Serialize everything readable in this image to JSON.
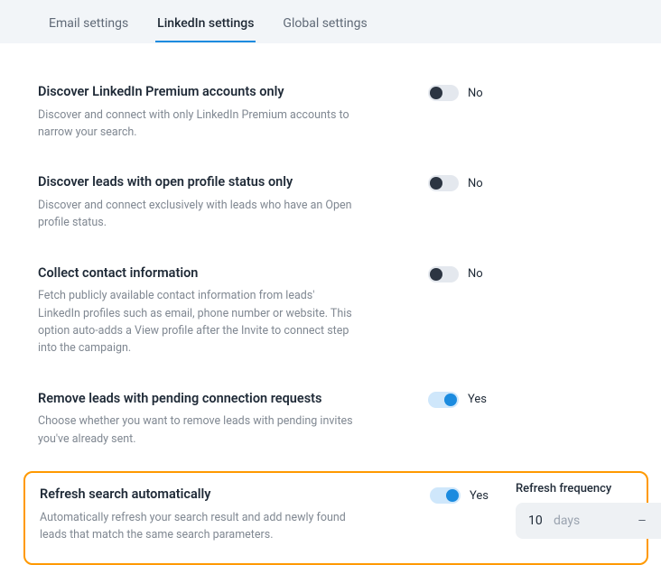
{
  "tabs": [
    {
      "label": "Email settings",
      "active": false
    },
    {
      "label": "LinkedIn settings",
      "active": true
    },
    {
      "label": "Global settings",
      "active": false
    }
  ],
  "settings": {
    "premium": {
      "title": "Discover LinkedIn Premium accounts only",
      "desc": "Discover and connect with only LinkedIn Premium accounts to narrow your search.",
      "value": false,
      "value_label": "No"
    },
    "open_profile": {
      "title": "Discover leads with open profile status only",
      "desc": "Discover and connect exclusively with leads who have an Open profile status.",
      "value": false,
      "value_label": "No"
    },
    "contact_info": {
      "title": "Collect contact information",
      "desc": "Fetch publicly available contact information from leads' LinkedIn profiles such as email, phone number or website. This option auto-adds a View profile after the Invite to connect step into the campaign.",
      "value": false,
      "value_label": "No"
    },
    "remove_pending": {
      "title": "Remove leads with pending connection requests",
      "desc": "Choose whether you want to remove leads with pending invites you've already sent.",
      "value": true,
      "value_label": "Yes"
    },
    "refresh": {
      "title": "Refresh search automatically",
      "desc": "Automatically refresh your search result and add newly found leads that match the same search parameters.",
      "value": true,
      "value_label": "Yes",
      "freq_label": "Refresh frequency",
      "freq_value": "10",
      "freq_unit": "days"
    }
  }
}
